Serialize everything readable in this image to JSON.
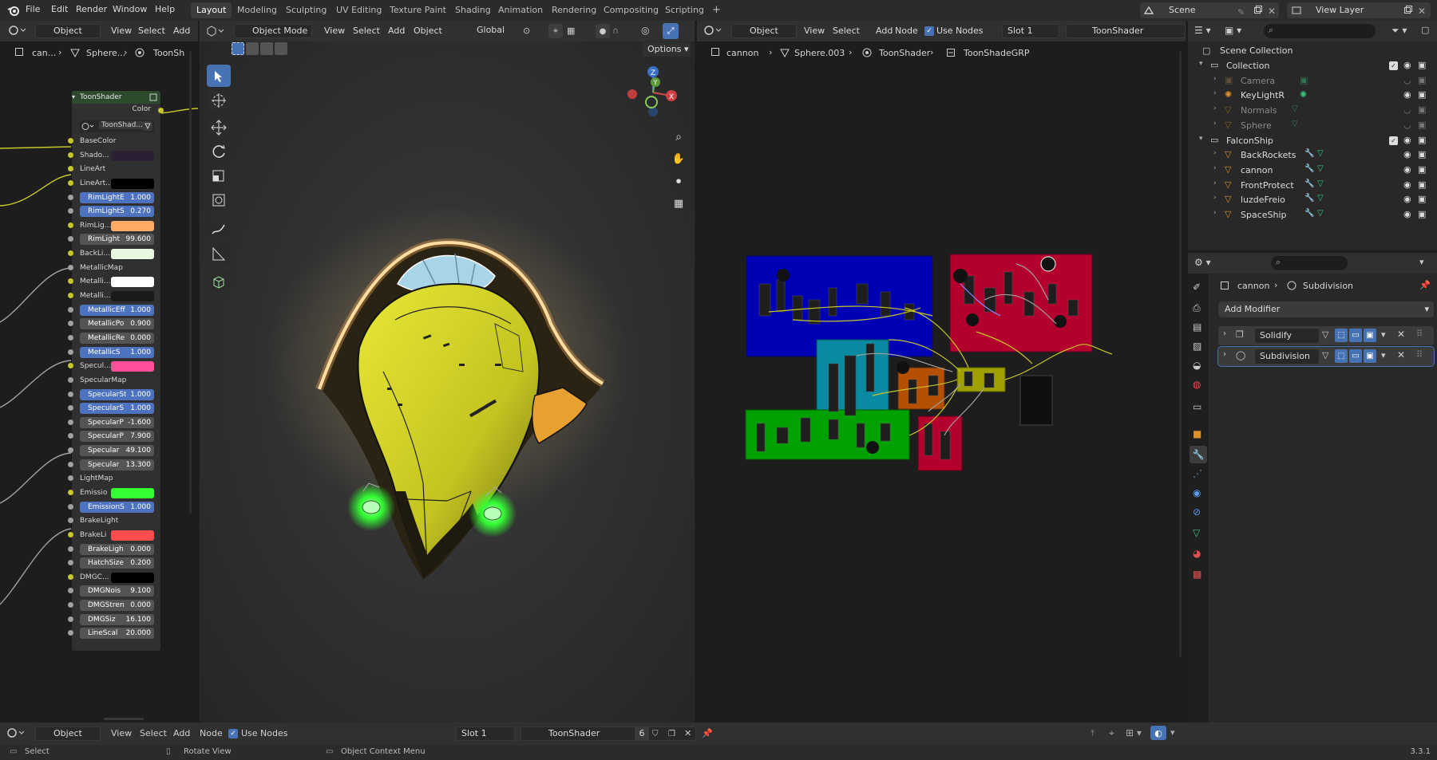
{
  "menu": {
    "items": [
      "File",
      "Edit",
      "Render",
      "Window",
      "Help"
    ]
  },
  "workspaces": [
    "Layout",
    "Modeling",
    "Sculpting",
    "UV Editing",
    "Texture Paint",
    "Shading",
    "Animation",
    "Rendering",
    "Compositing",
    "Scripting"
  ],
  "workspace_add": "+",
  "scene": {
    "name": "Scene",
    "view_layer": "View Layer"
  },
  "left_editor": {
    "mode": "Object",
    "menus": [
      "View",
      "Select",
      "Add"
    ],
    "breadcrumb": [
      "can...",
      "Sphere...",
      "ToonSh"
    ]
  },
  "viewport": {
    "mode": "Object Mode",
    "menus": [
      "View",
      "Select",
      "Add",
      "Object"
    ],
    "orientation": "Global",
    "options_label": "Options",
    "gizmo": {
      "z": "Z",
      "y": "Y",
      "x": "X"
    }
  },
  "node_editor": {
    "mode": "Object",
    "menus": [
      "View",
      "Select",
      "Add",
      "Node"
    ],
    "use_nodes_label": "Use Nodes",
    "slot": "Slot 1",
    "material": "ToonShader",
    "breadcrumb": [
      "cannon",
      "Sphere.003",
      "ToonShader",
      "ToonShadeGRP"
    ]
  },
  "node_card": {
    "title": "ToonShader",
    "output": "Color",
    "group_name": "ToonShad...",
    "sockets": [
      {
        "label": "BaseColor",
        "kind": "label",
        "dot": "#c7c729"
      },
      {
        "label": "Shado...",
        "kind": "color",
        "swatch": "#2a1f33",
        "dot": "#c7c729"
      },
      {
        "label": "LineArt",
        "kind": "label",
        "dot": "#c7c729"
      },
      {
        "label": "LineArt...",
        "kind": "color",
        "swatch": "#000000",
        "dot": "#c7c729"
      },
      {
        "label": "RimLightE",
        "value": "1.000",
        "kind": "field",
        "dot": "#a1a1a1"
      },
      {
        "label": "RimLightS",
        "value": "0.270",
        "kind": "field",
        "dot": "#a1a1a1"
      },
      {
        "label": "RimLig...",
        "kind": "color",
        "swatch": "#ffaa66",
        "dot": "#c7c729"
      },
      {
        "label": "RimLight",
        "value": "99.600",
        "kind": "fieldgrey",
        "dot": "#a1a1a1"
      },
      {
        "label": "BackLi...",
        "kind": "color",
        "swatch": "#e8f8e0",
        "dot": "#c7c729"
      },
      {
        "label": "MetallicMap",
        "kind": "label",
        "dot": "#a1a1a1"
      },
      {
        "label": "Metalli...",
        "kind": "color",
        "swatch": "#ffffff",
        "dot": "#c7c729"
      },
      {
        "label": "Metalli...",
        "kind": "color",
        "swatch": "#1a1a1a",
        "dot": "#c7c729"
      },
      {
        "label": "MetallicEff",
        "value": "1.000",
        "kind": "field",
        "dot": "#a1a1a1"
      },
      {
        "label": "MetallicPo",
        "value": "0.900",
        "kind": "fieldgrey",
        "dot": "#a1a1a1"
      },
      {
        "label": "MetallicRe",
        "value": "0.000",
        "kind": "fieldgrey",
        "dot": "#a1a1a1"
      },
      {
        "label": "MetallicS",
        "value": "1.000",
        "kind": "field",
        "dot": "#a1a1a1"
      },
      {
        "label": "Specul...",
        "kind": "color",
        "swatch": "#ff4d9a",
        "dot": "#c7c729"
      },
      {
        "label": "SpecularMap",
        "kind": "label",
        "dot": "#a1a1a1"
      },
      {
        "label": "SpecularSt",
        "value": "1.000",
        "kind": "field",
        "dot": "#a1a1a1"
      },
      {
        "label": "SpecularS",
        "value": "1.000",
        "kind": "field",
        "dot": "#a1a1a1"
      },
      {
        "label": "SpecularP",
        "value": "-1.600",
        "kind": "fieldgrey",
        "dot": "#a1a1a1"
      },
      {
        "label": "SpecularP",
        "value": "7.900",
        "kind": "fieldgrey",
        "dot": "#a1a1a1"
      },
      {
        "label": "Specular",
        "value": "49.100",
        "kind": "fieldgrey",
        "dot": "#a1a1a1"
      },
      {
        "label": "Specular",
        "value": "13.300",
        "kind": "fieldgrey",
        "dot": "#a1a1a1"
      },
      {
        "label": "LightMap",
        "kind": "label",
        "dot": "#a1a1a1"
      },
      {
        "label": "Emissio",
        "kind": "color",
        "swatch": "#33ff33",
        "dot": "#c7c729"
      },
      {
        "label": "EmissionS",
        "value": "1.000",
        "kind": "field",
        "dot": "#a1a1a1"
      },
      {
        "label": "BrakeLight",
        "kind": "label",
        "dot": "#a1a1a1"
      },
      {
        "label": "BrakeLi",
        "kind": "color",
        "swatch": "#ff4d4d",
        "dot": "#c7c729"
      },
      {
        "label": "BrakeLigh",
        "value": "0.000",
        "kind": "fieldgrey",
        "dot": "#a1a1a1"
      },
      {
        "label": "HatchSize",
        "value": "0.200",
        "kind": "fieldgrey",
        "dot": "#a1a1a1"
      },
      {
        "label": "DMGC...",
        "kind": "color",
        "swatch": "#000000",
        "dot": "#c7c729"
      },
      {
        "label": "DMGNois",
        "value": "9.100",
        "kind": "fieldgrey",
        "dot": "#a1a1a1"
      },
      {
        "label": "DMGStren",
        "value": "0.000",
        "kind": "fieldgrey",
        "dot": "#a1a1a1"
      },
      {
        "label": "DMGSiz",
        "value": "16.100",
        "kind": "fieldgrey",
        "dot": "#a1a1a1"
      },
      {
        "label": "LineScal",
        "value": "20.000",
        "kind": "fieldgrey",
        "dot": "#a1a1a1"
      }
    ]
  },
  "outliner": {
    "root": "Scene Collection",
    "rows": [
      {
        "name": "Collection",
        "level": 1,
        "icon": "collection-icon",
        "dim": false,
        "checkbox": true
      },
      {
        "name": "Camera",
        "level": 2,
        "icon": "camera-icon",
        "dim": true
      },
      {
        "name": "KeyLightR",
        "level": 2,
        "icon": "light-icon",
        "dim": false
      },
      {
        "name": "Normals",
        "level": 2,
        "icon": "mesh-icon",
        "dim": true
      },
      {
        "name": "Sphere",
        "level": 2,
        "icon": "mesh-icon",
        "dim": true
      },
      {
        "name": "FalconShip",
        "level": 1,
        "icon": "collection-icon",
        "dim": false,
        "checkbox": true
      },
      {
        "name": "BackRockets",
        "level": 2,
        "icon": "mesh-icon",
        "dim": false
      },
      {
        "name": "cannon",
        "level": 2,
        "icon": "mesh-icon",
        "dim": false
      },
      {
        "name": "FrontProtect",
        "level": 2,
        "icon": "mesh-icon",
        "dim": false
      },
      {
        "name": "luzdeFreio",
        "level": 2,
        "icon": "mesh-icon",
        "dim": false
      },
      {
        "name": "SpaceShip",
        "level": 2,
        "icon": "mesh-icon",
        "dim": false
      }
    ]
  },
  "properties": {
    "object": "cannon",
    "modifier_context": "Subdivision",
    "add_modifier": "Add Modifier",
    "modifiers": [
      {
        "name": "Solidify",
        "selected": false
      },
      {
        "name": "Subdivision",
        "selected": true
      }
    ]
  },
  "bottom_editor": {
    "mode": "Object",
    "menus": [
      "View",
      "Select",
      "Add",
      "Node"
    ],
    "use_nodes_label": "Use Nodes",
    "slot": "Slot 1",
    "material": "ToonShader",
    "users": "6"
  },
  "status": {
    "select": "Select",
    "rotate": "Rotate View",
    "context": "Object Context Menu",
    "version": "3.3.1"
  },
  "colors": {
    "accent": "#4772b3",
    "ship_body": "#d4d42a",
    "rim_light": "#ffb35a",
    "engine_glow": "#33ff33",
    "frame_blue": "#0000b4",
    "frame_red": "#b4002d",
    "frame_teal": "#0a8aa0",
    "frame_green": "#00a000",
    "frame_orange": "#b45000",
    "frame_olive": "#a0a000"
  }
}
